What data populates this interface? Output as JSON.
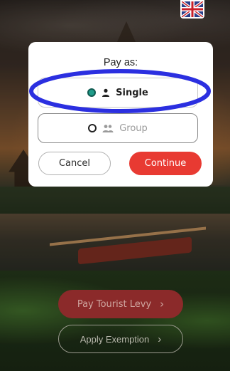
{
  "modal": {
    "title": "Pay as:",
    "options": [
      {
        "label": "Single",
        "icon": "person-icon",
        "selected": true
      },
      {
        "label": "Group",
        "icon": "people-icon",
        "selected": false
      }
    ],
    "cancel_label": "Cancel",
    "continue_label": "Continue"
  },
  "background_actions": {
    "pay_levy_label": "Pay Tourist Levy",
    "apply_exemption_label": "Apply Exemption"
  },
  "language": {
    "icon": "uk-flag-icon"
  },
  "colors": {
    "accent": "#e83a32",
    "selected_radio": "#1f9c8a",
    "highlight": "#2b2fe0"
  }
}
